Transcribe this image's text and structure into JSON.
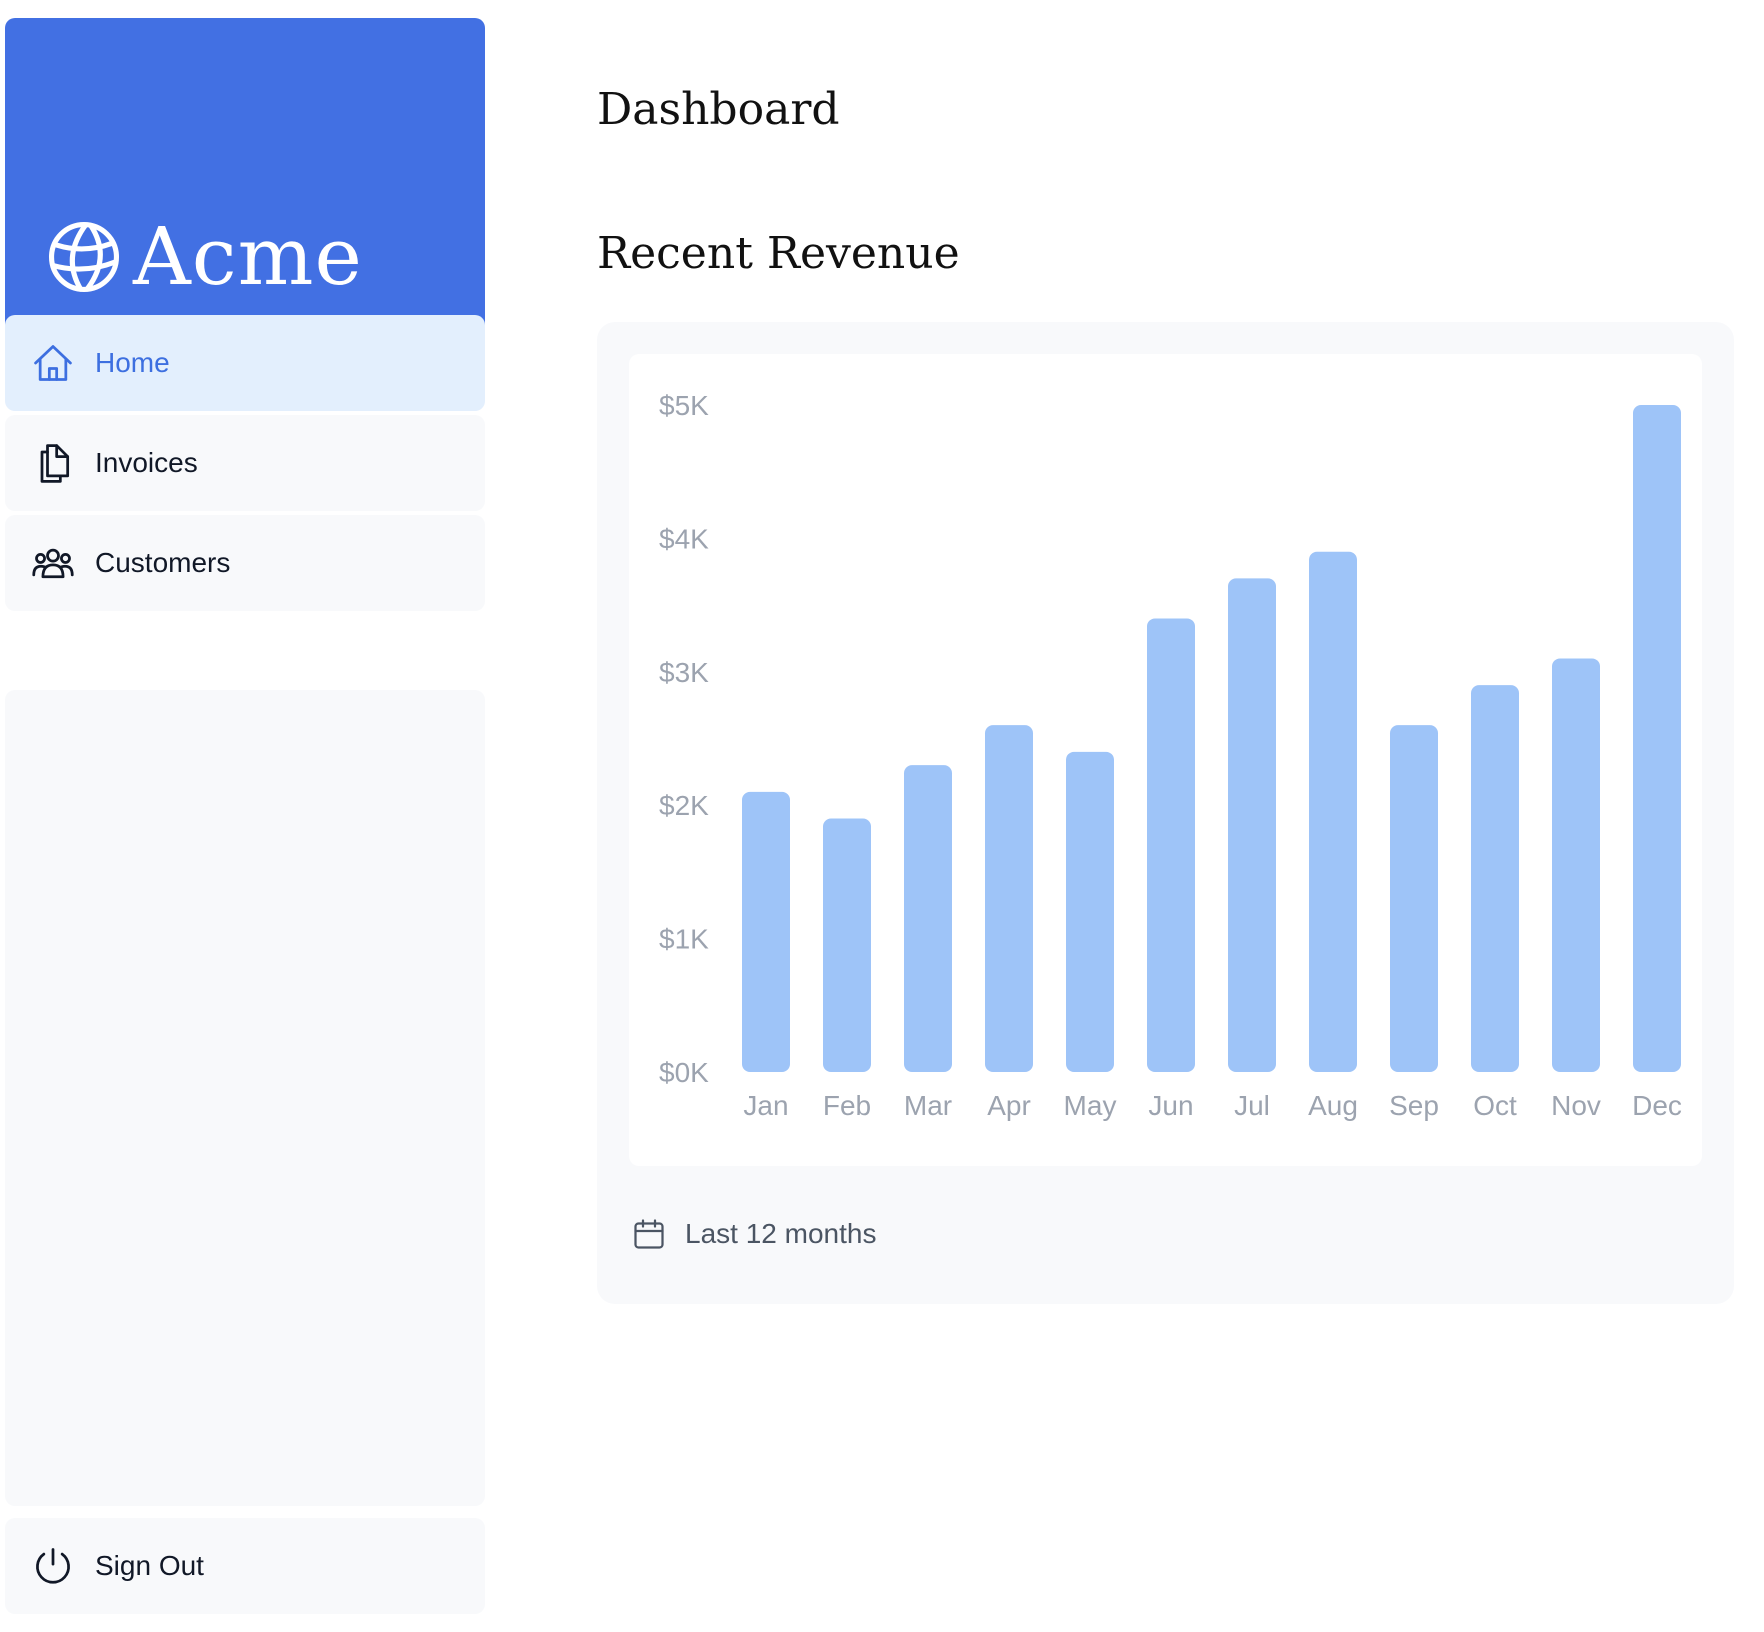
{
  "brand": {
    "name": "Acme",
    "logo_icon": "globe-icon",
    "color": "#4270e3"
  },
  "nav": {
    "items": [
      {
        "label": "Home",
        "icon": "home-icon",
        "active": true
      },
      {
        "label": "Invoices",
        "icon": "document-duplicate-icon",
        "active": false
      },
      {
        "label": "Customers",
        "icon": "user-group-icon",
        "active": false
      }
    ],
    "sign_out": {
      "label": "Sign Out",
      "icon": "power-icon"
    }
  },
  "page": {
    "title": "Dashboard"
  },
  "revenue": {
    "title": "Recent Revenue",
    "footer_label": "Last 12 months",
    "footer_icon": "calendar-icon"
  },
  "chart_data": {
    "type": "bar",
    "categories": [
      "Jan",
      "Feb",
      "Mar",
      "Apr",
      "May",
      "Jun",
      "Jul",
      "Aug",
      "Sep",
      "Oct",
      "Nov",
      "Dec"
    ],
    "values": [
      2100,
      1900,
      2300,
      2600,
      2400,
      3400,
      3700,
      3900,
      2600,
      2900,
      3100,
      5000
    ],
    "y_ticks": [
      "$5K",
      "$4K",
      "$3K",
      "$2K",
      "$1K",
      "$0K"
    ],
    "ylim": [
      0,
      5000
    ],
    "bar_color": "#9ec4f8",
    "tick_color": "#9ca3af",
    "grid": false
  }
}
